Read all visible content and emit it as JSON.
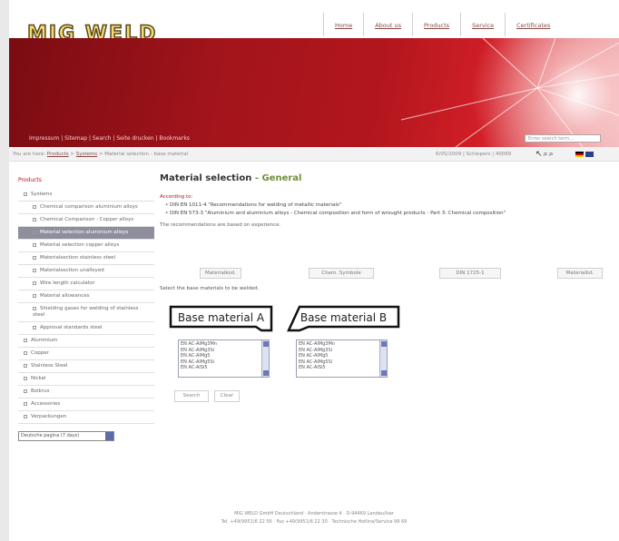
{
  "topnav": [
    "Home",
    "About us",
    "Products",
    "Service",
    "Certificates"
  ],
  "logo": "MIG WELD",
  "banner": {
    "quicklinks": "Impressum | Sitemap | Search | Seite drucken | Bookmarks",
    "search_placeholder": "Enter search term..."
  },
  "breadcrumb": {
    "prefix": "You are here:",
    "items": [
      "Products",
      "Systems"
    ],
    "current": "Material selection - base material",
    "meta": "6/05/2009 | Schiepers | 40069"
  },
  "sidebar": {
    "heading": "Products",
    "items": [
      {
        "label": "Systems",
        "level": 0
      },
      {
        "label": "Chemical comparison aluminium alloys",
        "level": 1
      },
      {
        "label": "Chemical Comparison - Copper alloys",
        "level": 1
      },
      {
        "label": "Material selection aluminium alloys",
        "level": 1,
        "active": true
      },
      {
        "label": "Material selection copper alloys",
        "level": 1
      },
      {
        "label": "Materialsection stainless steel",
        "level": 1
      },
      {
        "label": "Materialsection unalloyed",
        "level": 1
      },
      {
        "label": "Wire length calculator",
        "level": 1
      },
      {
        "label": "Material allowances",
        "level": 1
      },
      {
        "label": "Shielding gases for welding of stainless steel",
        "level": 1
      },
      {
        "label": "Approval standards steel",
        "level": 1
      },
      {
        "label": "Aluminium",
        "level": 0
      },
      {
        "label": "Copper",
        "level": 0
      },
      {
        "label": "Stainless Steel",
        "level": 0
      },
      {
        "label": "Nickel",
        "level": 0
      },
      {
        "label": "Bolkrus",
        "level": 0
      },
      {
        "label": "Accessories",
        "level": 0
      },
      {
        "label": "Verpackungen",
        "level": 0
      }
    ],
    "select_value": "Deutsche pagina (7 days)"
  },
  "main": {
    "title": "Material selection",
    "subtitle": " - General",
    "according": "According to:",
    "bullets": [
      "DIN EN 1011-4 \"Recommendations for welding of metallic materials\"",
      "DIN EN 573-3 \"Aluminium and aluminium alloys - Chemical composition and form of wrought products - Part 3: Chemical composition\""
    ],
    "note": "The recommendations are based on experience.",
    "filter_buttons": [
      "Materialkod.",
      "Chem. Symbole",
      "DIN 1725-1",
      "Materialkd."
    ],
    "select_hint": "Select the base materials to be welded.",
    "label_a": "Base material A",
    "label_b": "Base material B",
    "list_a": [
      "EN AC-AlMg3Mn",
      "EN AC-AlMg3Si",
      "EN AC-AlMg5",
      "EN AC-AlMg5Si",
      "EN AC-AlSi5"
    ],
    "list_b": [
      "EN AC-AlMg3Mn",
      "EN AC-AlMg3Si",
      "EN AC-AlMg5",
      "EN AC-AlMg5Si",
      "EN AC-AlSi5"
    ],
    "search_label": "Search",
    "clear_label": "Clear"
  },
  "footer": {
    "line1": "MIG WELD GmbH Deutschland · Anderstrasse 4 · D-94469 Landau/Isar",
    "line2": "Tel. +49(9951)6 22 56 · Fax +49(9951)6 22 30 · Technische Hotline/Service 99 69"
  },
  "colors": {
    "brand_red": "#b3121b",
    "accent_green": "#6f8f3a",
    "active_nav": "#8f8f9c"
  }
}
